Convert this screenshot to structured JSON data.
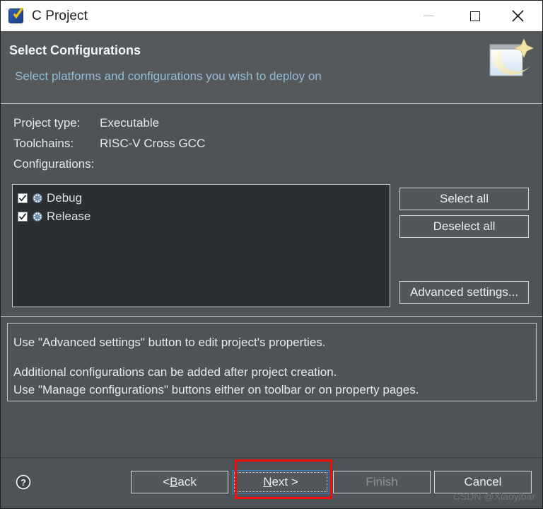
{
  "window": {
    "title": "C Project",
    "app_icon": "blue-check-icon",
    "controls": {
      "minimize": "minimize-icon",
      "maximize": "maximize-icon",
      "close": "close-icon"
    }
  },
  "header": {
    "title": "Select Configurations",
    "subtitle": "Select platforms and configurations you wish to deploy on",
    "banner_icon": "eclipse-wizard-banner-icon"
  },
  "info": {
    "rows": [
      {
        "label": "Project type:",
        "value": "Executable"
      },
      {
        "label": "Toolchains:",
        "value": "RISC-V Cross GCC"
      },
      {
        "label": "Configurations:",
        "value": ""
      }
    ]
  },
  "configurations": {
    "items": [
      {
        "label": "Debug",
        "checked": true,
        "icon": "build-config-icon"
      },
      {
        "label": "Release",
        "checked": true,
        "icon": "build-config-icon"
      }
    ]
  },
  "side_buttons": {
    "select_all": "Select all",
    "deselect_all": "Deselect all",
    "advanced_settings": "Advanced settings..."
  },
  "note": {
    "line1": "Use \"Advanced settings\" button to edit project's properties.",
    "line2": "Additional configurations can be added after project creation.",
    "line3": "Use \"Manage configurations\" buttons either on toolbar or on property pages."
  },
  "footer": {
    "help_icon": "help-icon",
    "back": {
      "prefix": "< ",
      "accel": "B",
      "suffix": "ack"
    },
    "next": {
      "accel": "N",
      "suffix": "ext >"
    },
    "finish": "Finish",
    "cancel": "Cancel"
  },
  "watermark": "CSDN @Xiaoyibar",
  "colors": {
    "dialog_background": "#4d5356",
    "header_background": "#55595b",
    "titlebar_background": "#ffffff",
    "list_background": "#2b2f31",
    "subtitle_text": "#93bcd4",
    "focus_border": "#2a7fc9",
    "annotation_red": "#f60a0a",
    "disabled_text": "#8d9497"
  }
}
